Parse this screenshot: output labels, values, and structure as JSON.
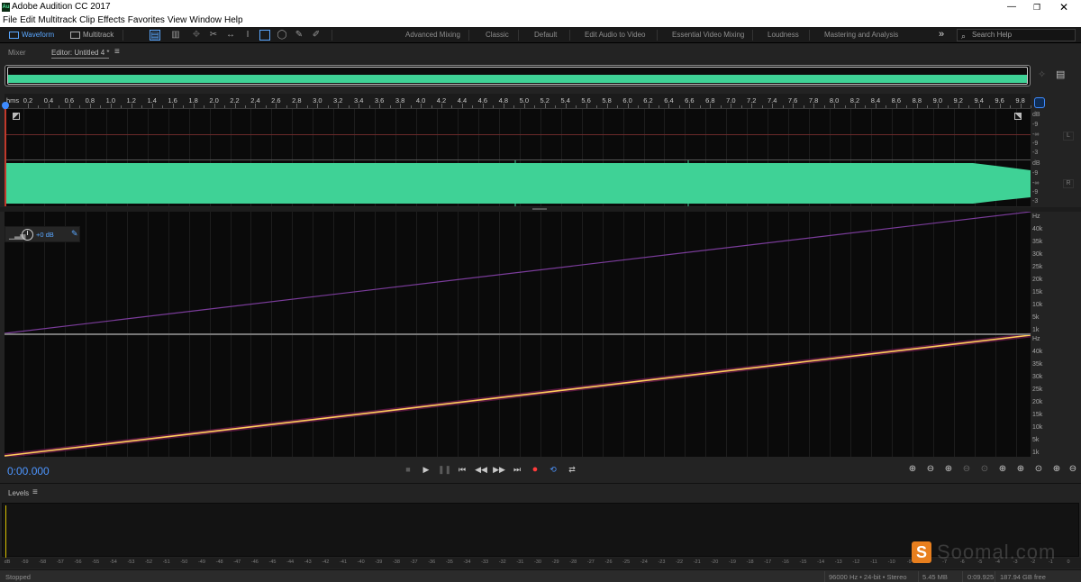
{
  "window": {
    "title": "Adobe Audition CC 2017",
    "icon_label": "Au",
    "icon": "app-logo-icon"
  },
  "menu": [
    "File",
    "Edit",
    "Multitrack",
    "Clip",
    "Effects",
    "Favorites",
    "View",
    "Window",
    "Help"
  ],
  "toolbar": {
    "waveform_label": "Waveform",
    "multitrack_label": "Multitrack",
    "workspaces": [
      "Advanced Mixing",
      "Classic",
      "Default",
      "Edit Audio to Video",
      "Essential Video Mixing",
      "Loudness",
      "Mastering and Analysis"
    ],
    "search_placeholder": "Search Help",
    "overflow": "»",
    "colors": {
      "accent": "#5aa7ff"
    }
  },
  "panels": {
    "mixer_tab": "Mixer",
    "editor_tab": "Editor: Untitled 4 *",
    "menu_glyph": "≡"
  },
  "ruler": {
    "unit": "hms",
    "labels": [
      "0.2",
      "0.4",
      "0.6",
      "0.8",
      "1.0",
      "1.2",
      "1.4",
      "1.6",
      "1.8",
      "2.0",
      "2.2",
      "2.4",
      "2.6",
      "2.8",
      "3.0",
      "3.2",
      "3.4",
      "3.6",
      "3.8",
      "4.0",
      "4.2",
      "4.4",
      "4.6",
      "4.8",
      "5.0",
      "5.2",
      "5.4",
      "5.6",
      "5.8",
      "6.0",
      "6.2",
      "6.4",
      "6.6",
      "6.8",
      "7.0",
      "7.2",
      "7.4",
      "7.6",
      "7.8",
      "8.0",
      "8.2",
      "8.4",
      "8.6",
      "8.8",
      "9.0",
      "9.2",
      "9.4",
      "9.6",
      "9.8"
    ]
  },
  "waveform": {
    "color": "#3fd296",
    "left_channel_label": "L",
    "right_channel_label": "R",
    "db_scale": [
      "dB",
      "-9",
      "-∞",
      "-9",
      "-3"
    ]
  },
  "spectral": {
    "hz_scale_top": [
      "Hz",
      "40k",
      "35k",
      "30k",
      "25k",
      "20k",
      "15k",
      "10k",
      "5k",
      "1k"
    ],
    "hz_scale_bottom": [
      "Hz",
      "40k",
      "35k",
      "30k",
      "25k",
      "20k",
      "15k",
      "10k",
      "5k",
      "1k"
    ],
    "gain_readout": "+0 dB",
    "sweep_color_top": "#7a3c9a",
    "sweep_color_bottom": "#ffcf5a"
  },
  "transport": {
    "timecode": "0:00.000",
    "buttons": [
      "stop-icon",
      "play-icon",
      "pause-icon",
      "go-to-start-icon",
      "rewind-icon",
      "fast-forward-icon",
      "go-to-end-icon",
      "record-icon",
      "loop-icon",
      "skip-selection-icon"
    ]
  },
  "zoom_buttons": [
    "zoom-in-amplitude-icon",
    "zoom-out-amplitude-icon",
    "zoom-in-time-icon",
    "zoom-out-time-icon",
    "zoom-out-full-icon",
    "zoom-in-left-icon",
    "zoom-in-right-icon",
    "zoom-selection-icon",
    "zoom-in-selection-icon",
    "zoom-out-selection-icon"
  ],
  "levels": {
    "title": "Levels",
    "menu_glyph": "≡",
    "scale": [
      "dB",
      "-59",
      "-58",
      "-57",
      "-56",
      "-55",
      "-54",
      "-53",
      "-52",
      "-51",
      "-50",
      "-49",
      "-48",
      "-47",
      "-46",
      "-45",
      "-44",
      "-43",
      "-42",
      "-41",
      "-40",
      "-39",
      "-38",
      "-37",
      "-36",
      "-35",
      "-34",
      "-33",
      "-32",
      "-31",
      "-30",
      "-29",
      "-28",
      "-27",
      "-26",
      "-25",
      "-24",
      "-23",
      "-22",
      "-21",
      "-20",
      "-19",
      "-18",
      "-17",
      "-16",
      "-15",
      "-14",
      "-13",
      "-12",
      "-11",
      "-10",
      "-9",
      "-8",
      "-7",
      "-6",
      "-5",
      "-4",
      "-3",
      "-2",
      "-1",
      "0"
    ]
  },
  "status": {
    "state": "Stopped",
    "format": "96000 Hz • 24-bit • Stereo",
    "file_size": "5.45 MB",
    "duration": "0:09.925",
    "free_space": "187.94 GB free"
  },
  "watermark": {
    "logo_text": "S",
    "text": "Soomal.com"
  }
}
